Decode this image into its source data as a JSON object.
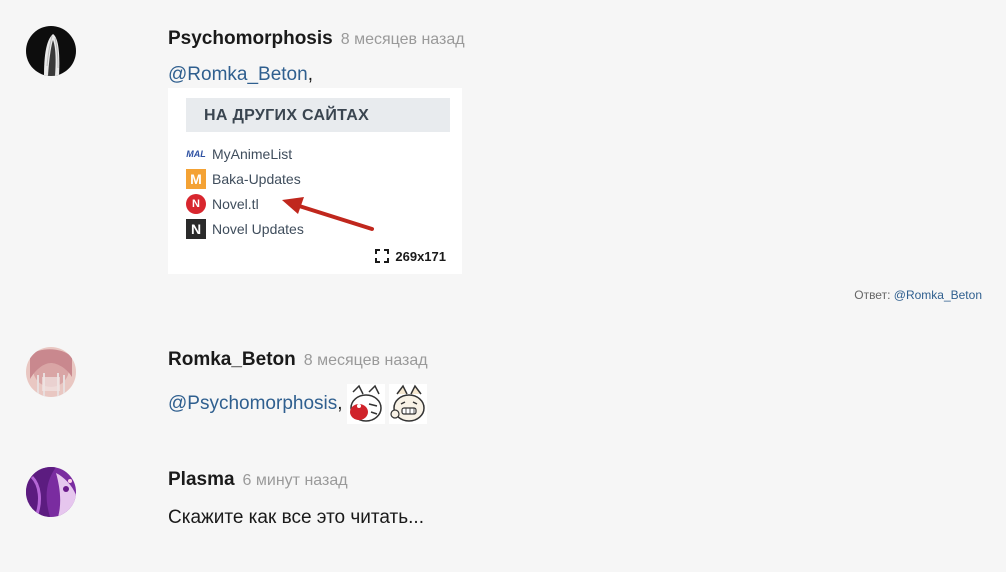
{
  "comments": [
    {
      "author": "Psychomorphosis",
      "time": "8 месяцев назад",
      "mention": "@Romka_Beton",
      "text_suffix": ",",
      "attachment": {
        "header": "НА ДРУГИХ САЙТАХ",
        "links": [
          "MyAnimeList",
          "Baka-Updates",
          "Novel.tl",
          "Novel Updates"
        ],
        "icons": [
          "MAL",
          "M",
          "N",
          "N"
        ],
        "size": "269x171"
      },
      "reply_label": "Ответ:",
      "reply_to": "@Romka_Beton"
    },
    {
      "author": "Romka_Beton",
      "time": "8 месяцев назад",
      "mention": "@Psychomorphosis",
      "text_suffix": ","
    },
    {
      "author": "Plasma",
      "time": "6 минут назад",
      "text": "Скажите как все это читать..."
    }
  ],
  "colors": {
    "background": "#f6f6f6",
    "mention": "#2f5f8f",
    "timestamp": "#9a9a9a",
    "arrow": "#c0271d"
  }
}
